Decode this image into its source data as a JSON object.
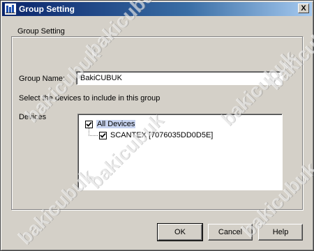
{
  "window": {
    "title": "Group Setting",
    "icon": "app-icon",
    "close_label": "X"
  },
  "group": {
    "legend": "Group Setting",
    "name_label": "Group Name:",
    "name_value": "BakiCUBUK",
    "select_text": "Select the devices to include in this group",
    "devices_label": "Devices",
    "tree": [
      {
        "label": "All Devices",
        "checked": true,
        "selected": true
      },
      {
        "label": "SCANTEX [7076035DD0D5E]",
        "checked": true,
        "selected": false
      }
    ]
  },
  "buttons": {
    "ok": "OK",
    "cancel": "Cancel",
    "help": "Help"
  },
  "watermark": "bakicubuk",
  "colors": {
    "title_bar": "#0a246a",
    "face": "#d4d0c8",
    "selection": "#c8d4f0"
  }
}
